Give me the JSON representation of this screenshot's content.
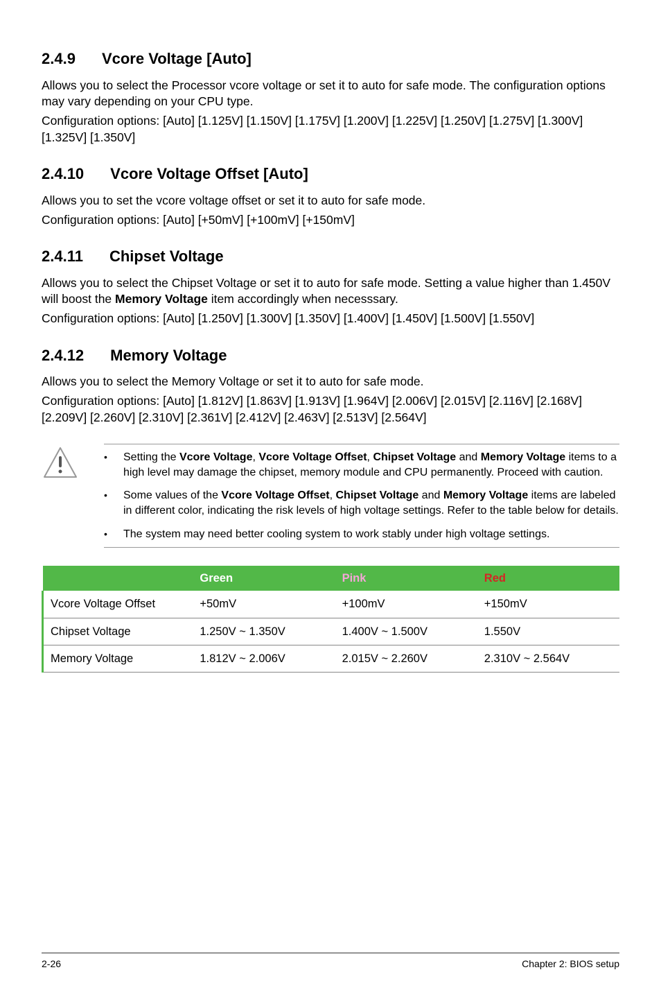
{
  "sections": {
    "s1": {
      "number": "2.4.9",
      "title": "Vcore Voltage [Auto]",
      "p1": "Allows you to select the Processor vcore voltage or set it to auto for safe mode. The configuration options may vary depending on your CPU type.",
      "p2": "Configuration options: [Auto] [1.125V] [1.150V] [1.175V] [1.200V] [1.225V] [1.250V] [1.275V] [1.300V] [1.325V] [1.350V]"
    },
    "s2": {
      "number": "2.4.10",
      "title": "Vcore Voltage Offset [Auto]",
      "p1": "Allows you to set the vcore voltage offset or set it to auto for safe mode.",
      "p2": "Configuration options: [Auto] [+50mV] [+100mV] [+150mV]"
    },
    "s3": {
      "number": "2.4.11",
      "title": "Chipset Voltage",
      "p1a": "Allows you to select the Chipset Voltage or set it to auto for safe mode. Setting a value higher than 1.450V will boost the ",
      "p1b": "Memory Voltage",
      "p1c": " item accordingly when necesssary.",
      "p2": "Configuration options: [Auto] [1.250V] [1.300V] [1.350V] [1.400V] [1.450V] [1.500V] [1.550V]"
    },
    "s4": {
      "number": "2.4.12",
      "title": "Memory Voltage",
      "p1": "Allows you to select the Memory Voltage or set it to auto for safe mode.",
      "p2": "Configuration options: [Auto] [1.812V] [1.863V] [1.913V] [1.964V] [2.006V] [2.015V] [2.116V] [2.168V] [2.209V] [2.260V] [2.310V] [2.361V] [2.412V] [2.463V] [2.513V] [2.564V]"
    }
  },
  "callout": {
    "item1": {
      "a": "Setting the ",
      "b": "Vcore Voltage",
      "c": ", ",
      "d": "Vcore Voltage Offset",
      "e": ", ",
      "f": "Chipset Voltage",
      "g": " and ",
      "h": "Memory Voltage",
      "i": " items to a high level may damage the chipset, memory module and CPU permanently. Proceed with caution."
    },
    "item2": {
      "a": "Some values of the ",
      "b": "Vcore Voltage Offset",
      "c": ", ",
      "d": "Chipset Voltage",
      "e": " and ",
      "f": "Memory Voltage",
      "g": " items are labeled in different color, indicating the risk levels of high voltage settings. Refer to the table below for details."
    },
    "item3": "The system may need better cooling system to work stably under high voltage settings."
  },
  "table": {
    "headers": {
      "green": "Green",
      "pink": "Pink",
      "red": "Red"
    },
    "rows": [
      {
        "label": "Vcore Voltage Offset",
        "green": "+50mV",
        "pink": "+100mV",
        "red": "+150mV"
      },
      {
        "label": "Chipset Voltage",
        "green": "1.250V ~ 1.350V",
        "pink": "1.400V ~ 1.500V",
        "red": "1.550V"
      },
      {
        "label": "Memory Voltage",
        "green": "1.812V ~ 2.006V",
        "pink": "2.015V ~ 2.260V",
        "red": "2.310V ~ 2.564V"
      }
    ]
  },
  "footer": {
    "left": "2-26",
    "right": "Chapter 2: BIOS setup"
  }
}
